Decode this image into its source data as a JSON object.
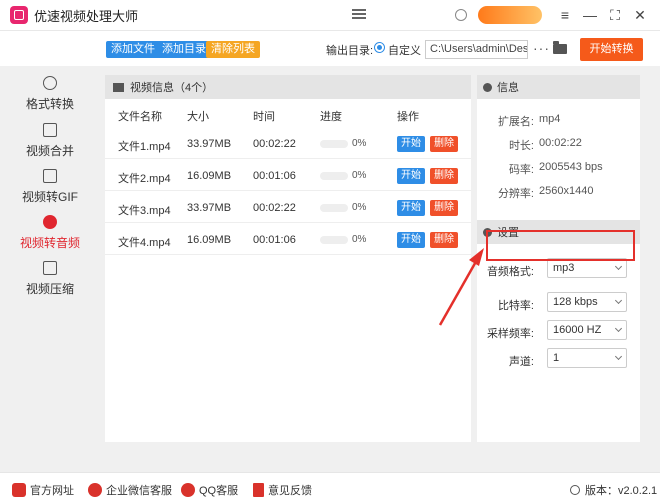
{
  "app": {
    "title": "优速视频处理大师"
  },
  "toolbar": {
    "add_file": "添加文件",
    "add_dir": "添加目录",
    "clear_list": "清除列表",
    "output_label": "输出目录:",
    "custom_label": "自定义",
    "path": "C:\\Users\\admin\\Deskto",
    "more": "···",
    "start_convert": "开始转换"
  },
  "sidebar": {
    "items": [
      {
        "label": "格式转换",
        "icon": "format-convert-icon"
      },
      {
        "label": "视频合并",
        "icon": "video-merge-icon"
      },
      {
        "label": "视频转GIF",
        "icon": "gif-icon"
      },
      {
        "label": "视频转音频",
        "icon": "audio-icon",
        "active": true
      },
      {
        "label": "视频压缩",
        "icon": "compress-icon"
      }
    ]
  },
  "files": {
    "title": "视频信息（4个）",
    "columns": {
      "name": "文件名称",
      "size": "大小",
      "time": "时间",
      "progress": "进度",
      "action": "操作"
    },
    "rows": [
      {
        "name": "文件1.mp4",
        "size": "33.97MB",
        "time": "00:02:22",
        "progress": 0,
        "pct": "0%",
        "start": "开始",
        "del": "删除"
      },
      {
        "name": "文件2.mp4",
        "size": "16.09MB",
        "time": "00:01:06",
        "progress": 0,
        "pct": "0%",
        "start": "开始",
        "del": "删除"
      },
      {
        "name": "文件3.mp4",
        "size": "33.97MB",
        "time": "00:02:22",
        "progress": 0,
        "pct": "0%",
        "start": "开始",
        "del": "删除"
      },
      {
        "name": "文件4.mp4",
        "size": "16.09MB",
        "time": "00:01:06",
        "progress": 0,
        "pct": "0%",
        "start": "开始",
        "del": "删除"
      }
    ]
  },
  "info": {
    "title": "信息",
    "rows": [
      {
        "k": "扩展名:",
        "v": "mp4"
      },
      {
        "k": "时长:",
        "v": "00:02:22"
      },
      {
        "k": "码率:",
        "v": "2005543 bps"
      },
      {
        "k": "分辨率:",
        "v": "2560x1440"
      }
    ]
  },
  "settings": {
    "title": "设置",
    "rows": [
      {
        "k": "音频格式:",
        "v": "mp3"
      },
      {
        "k": "比特率:",
        "v": "128 kbps"
      },
      {
        "k": "采样频率:",
        "v": "16000 HZ"
      },
      {
        "k": "声道:",
        "v": "1"
      }
    ]
  },
  "footer": {
    "website": "官方网址",
    "wechat": "企业微信客服",
    "qq": "QQ客服",
    "feedback": "意见反馈",
    "version": "版本：v2.0.2.1"
  },
  "colors": {
    "blue": "#2e8de6",
    "orange": "#f5a623",
    "red": "#e0262f",
    "start": "#f55a1a"
  }
}
